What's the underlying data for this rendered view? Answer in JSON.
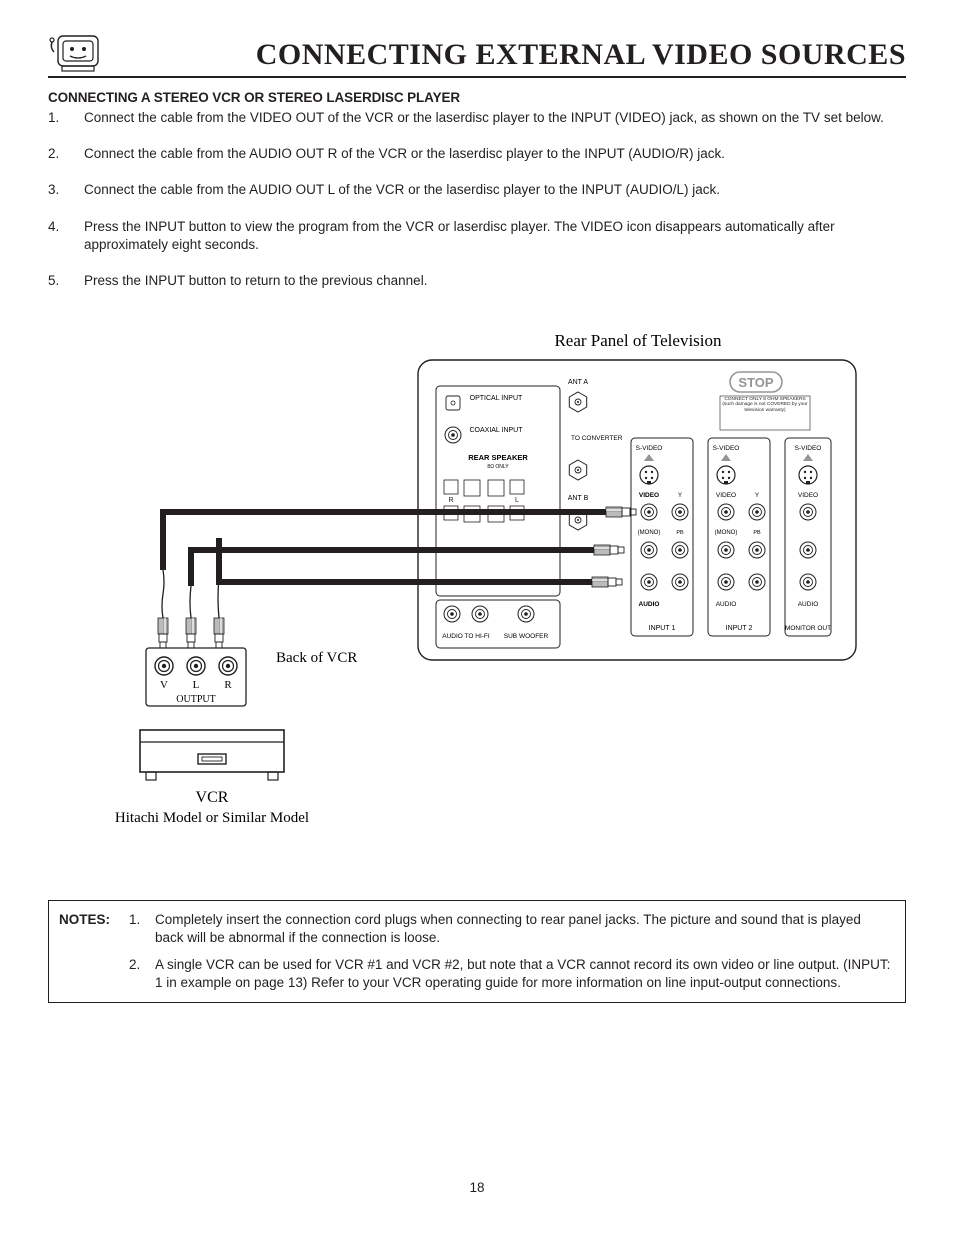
{
  "header": {
    "title": "CONNECTING EXTERNAL VIDEO SOURCES"
  },
  "section": {
    "subhead": "CONNECTING A STEREO VCR OR STEREO LASERDISC PLAYER",
    "steps": [
      "Connect the cable from the VIDEO OUT of the VCR or the laserdisc player to the INPUT (VIDEO) jack, as shown on the TV set below.",
      "Connect the cable from the AUDIO OUT R of the VCR or the laserdisc player to the INPUT (AUDIO/R) jack.",
      "Connect the cable from the AUDIO OUT L of the VCR or the laserdisc player to the INPUT (AUDIO/L) jack.",
      "Press the INPUT button to view the program from the VCR or laserdisc player.  The VIDEO icon disappears automatically after approximately eight seconds.",
      "Press the INPUT button to return to the previous channel."
    ]
  },
  "diagram": {
    "caption": "Rear Panel of Television",
    "vcr_back": "Back of VCR",
    "vcr_output_labels": {
      "v": "V",
      "l": "L",
      "r": "R",
      "output": "OUTPUT"
    },
    "vcr_label": "VCR",
    "vcr_model": "Hitachi Model or Similar Model",
    "stop": "STOP",
    "stop_note": "CONNECT ONLY 8 OHM SPEAKERS (such damage is not COVERED by your television warranty)",
    "panels": {
      "optical": "OPTICAL INPUT",
      "coaxial": "COAXIAL INPUT",
      "rear_speaker": "REAR SPEAKER",
      "rear_speaker_sub": "8Ω ONLY",
      "r": "R",
      "l": "L",
      "ant_a": "ANT A",
      "to_conv": "TO CONVERTER",
      "ant_b": "ANT B",
      "audio_hifi": "AUDIO TO HI-FI",
      "sub_woofer": "SUB WOOFER",
      "svideo": "S-VIDEO",
      "video": "VIDEO",
      "mono": "(MONO)",
      "y": "Y",
      "pb": "PB",
      "audio": "AUDIO",
      "input1": "INPUT 1",
      "input2": "INPUT 2",
      "monitor_out": "MONITOR OUT"
    }
  },
  "notes": {
    "label": "NOTES:",
    "items": [
      "Completely insert the connection cord plugs when connecting to rear panel jacks.  The picture and sound that is played back will be abnormal if the connection is loose.",
      "A single VCR can be used for VCR #1 and VCR #2, but note that a VCR cannot record its own video or line output.  (INPUT: 1 in example on page 13)  Refer to your VCR operating guide for more information on line input-output connections."
    ]
  },
  "page_number": "18"
}
